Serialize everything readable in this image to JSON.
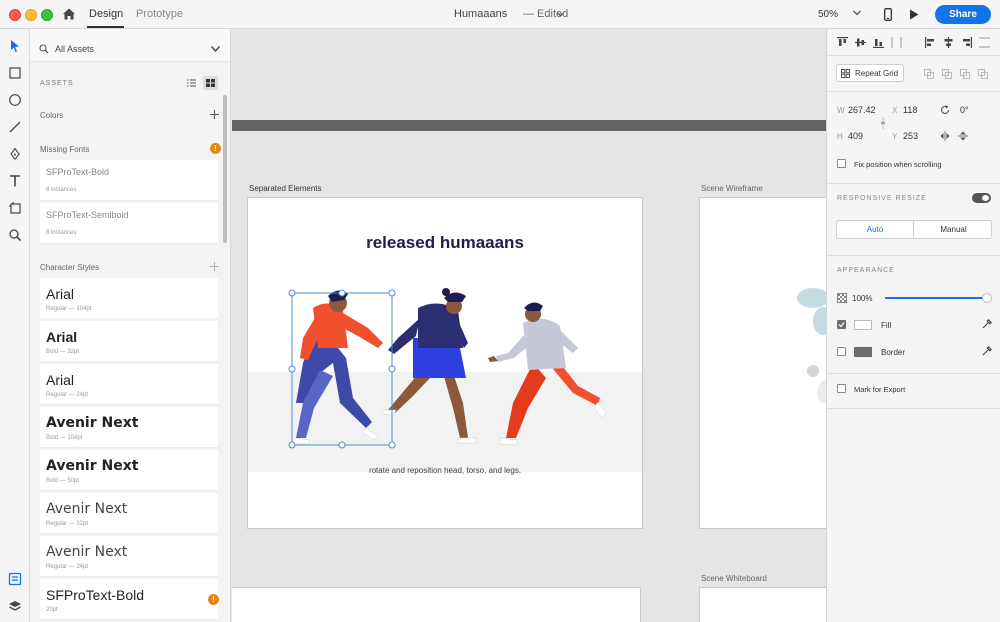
{
  "titlebar": {
    "tabs": [
      {
        "label": "Design"
      },
      {
        "label": "Prototype"
      }
    ],
    "document_title": "Humaaans",
    "document_status": "—  Edited",
    "zoom": "50%",
    "share_label": "Share"
  },
  "assets": {
    "filter": "All Assets",
    "header": "ASSETS",
    "colors_label": "Colors",
    "missing_fonts_label": "Missing Fonts",
    "missing_fonts": [
      {
        "name": "SFProText-Bold",
        "instances": "8 instances"
      },
      {
        "name": "SFProText-Semibold",
        "instances": "8 instances"
      }
    ],
    "character_styles_label": "Character Styles",
    "character_styles": [
      {
        "name": "Arial",
        "meta": "Regular — 104pt"
      },
      {
        "name": "Arial",
        "meta": "Bold — 32pt"
      },
      {
        "name": "Arial",
        "meta": "Regular — 24pt"
      },
      {
        "name": "Avenir Next",
        "meta": "Bold — 104pt"
      },
      {
        "name": "Avenir Next",
        "meta": "Bold — 50pt"
      },
      {
        "name": "Avenir Next",
        "meta": "Regular — 32pt"
      },
      {
        "name": "Avenir Next",
        "meta": "Regular — 24pt"
      },
      {
        "name": "SFProText-Bold",
        "meta": "20pt"
      }
    ],
    "warning_glyph": "!"
  },
  "canvas": {
    "artboards": [
      {
        "label": "Separated Elements"
      },
      {
        "label": "Scene Wireframe"
      },
      {
        "label": "Scene Whiteboard"
      }
    ],
    "hero_title": "released humaaans",
    "caption": "rotate and reposition head, torso, and legs."
  },
  "inspector": {
    "repeat_grid": "Repeat Grid",
    "w_label": "W",
    "w": "267.42",
    "x_label": "X",
    "x": "118",
    "rotation": "0°",
    "h_label": "H",
    "h": "409",
    "y_label": "Y",
    "y": "253",
    "fix_position": "Fix position when scrolling",
    "responsive_resize": "RESPONSIVE RESIZE",
    "resize_modes": [
      "Auto",
      "Manual"
    ],
    "appearance": "APPEARANCE",
    "opacity": "100%",
    "opacity_level": 1.0,
    "fill_label": "Fill",
    "border_label": "Border",
    "export_label": "Mark for Export"
  },
  "colors": {
    "accent": "#1473e6",
    "title_navy": "#1f1d4f",
    "selection": "#4a90d9"
  }
}
